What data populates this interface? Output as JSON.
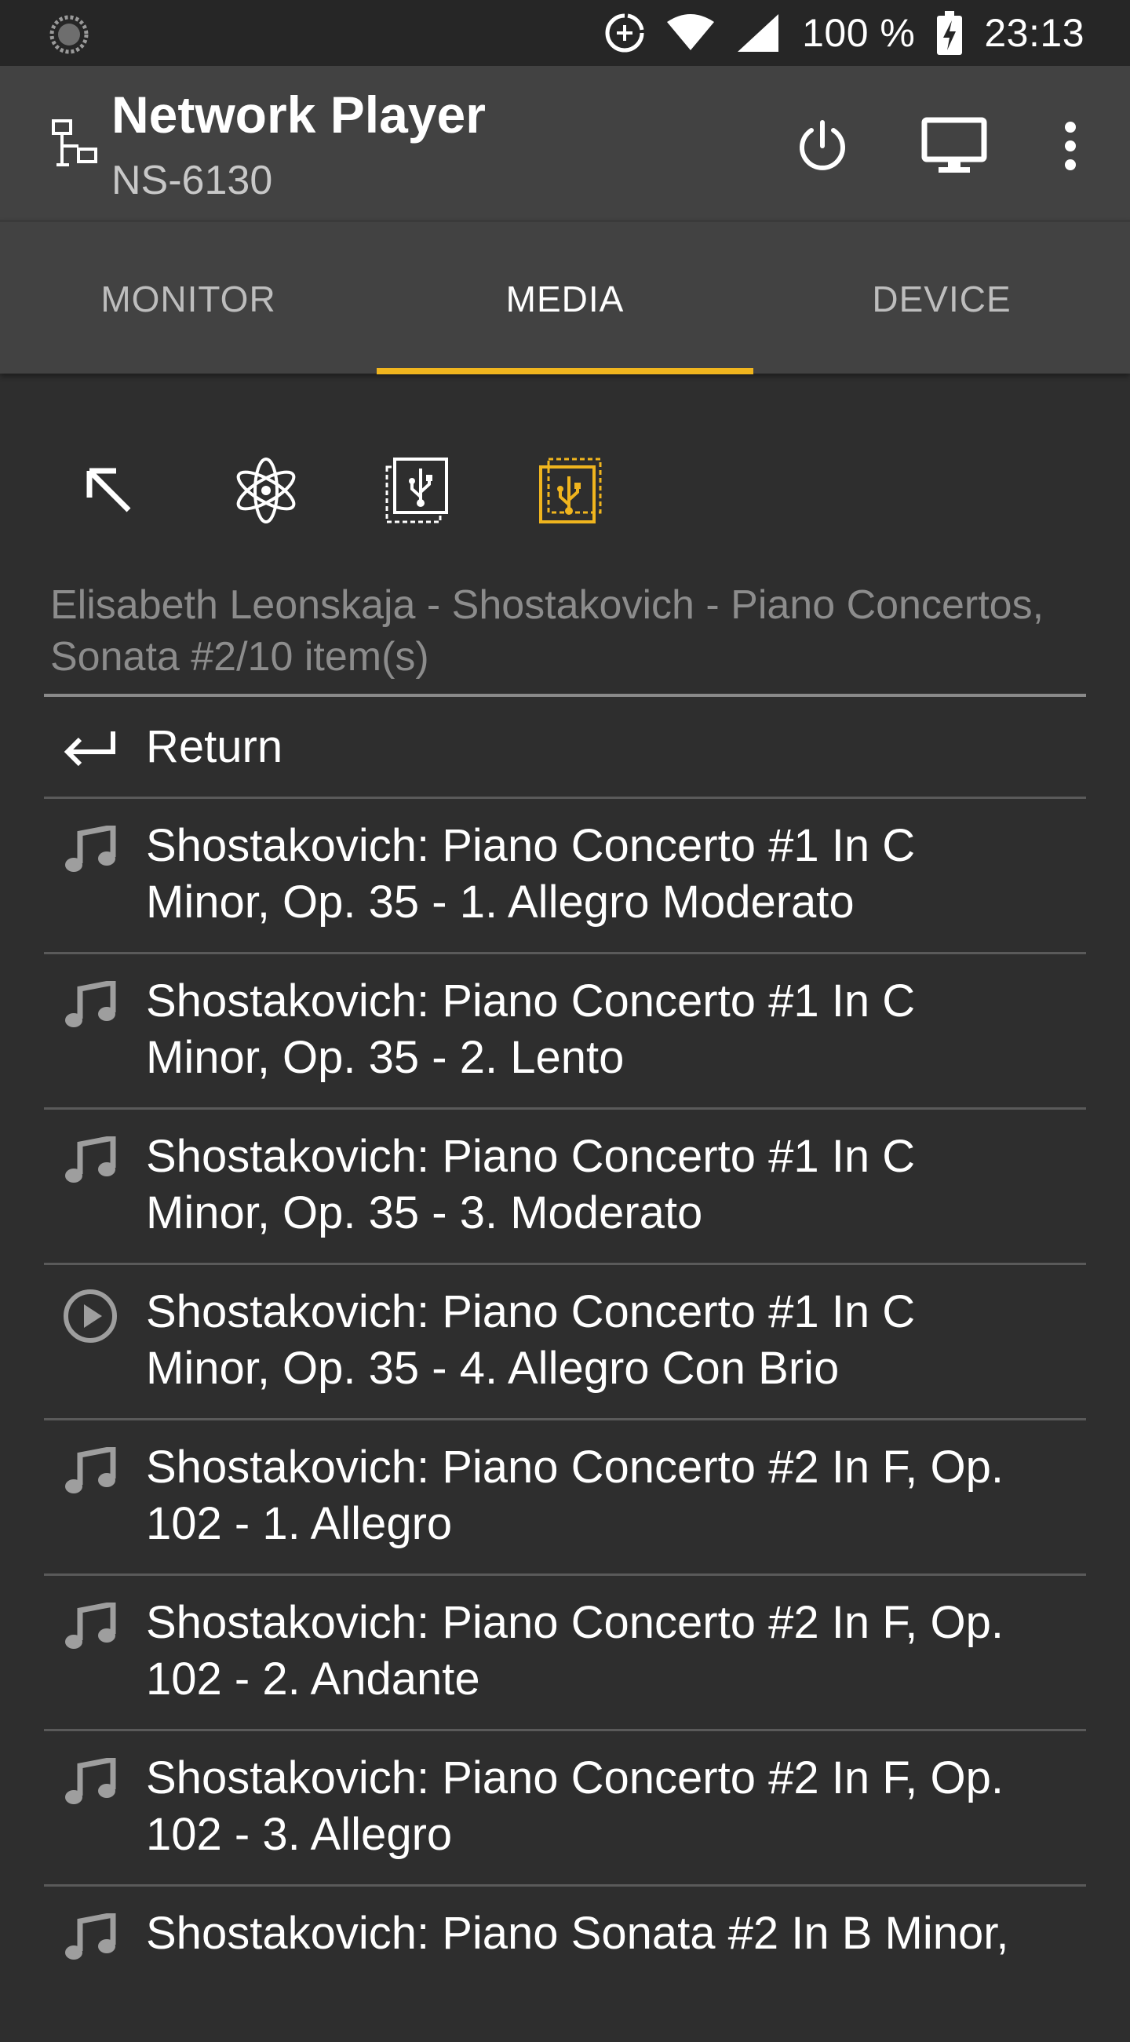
{
  "status_bar": {
    "battery": "100 %",
    "time": "23:13",
    "icons": [
      "loading-icon",
      "data-saver-icon",
      "wifi-icon",
      "signal-icon",
      "battery-charging-icon"
    ]
  },
  "app_bar": {
    "title": "Network Player",
    "subtitle": "NS-6130",
    "icons": [
      "network-icon",
      "power-icon",
      "monitor-icon",
      "more-vert-icon"
    ]
  },
  "tabs": [
    {
      "label": "MONITOR",
      "active": false
    },
    {
      "label": "MEDIA",
      "active": true
    },
    {
      "label": "DEVICE",
      "active": false
    }
  ],
  "accent_color": "#f0b51e",
  "toolbar": {
    "icons": [
      "home-arrow-icon",
      "internet-radio-icon",
      "usb-rear-icon",
      "usb-front-icon"
    ],
    "selected": "usb-front-icon"
  },
  "browser": {
    "path": "Elisabeth Leonskaja - Shostakovich - Piano Concertos, Sonata #2/10 item(s)",
    "return_label": "Return",
    "items": [
      {
        "icon": "music-note-icon",
        "line1": "Shostakovich: Piano Concerto #1 In C",
        "line2": "Minor, Op. 35 - 1. Allegro Moderato"
      },
      {
        "icon": "music-note-icon",
        "line1": "Shostakovich: Piano Concerto #1 In C",
        "line2": "Minor, Op. 35 - 2. Lento"
      },
      {
        "icon": "music-note-icon",
        "line1": "Shostakovich: Piano Concerto #1 In C",
        "line2": "Minor, Op. 35 - 3. Moderato"
      },
      {
        "icon": "play-circle-icon",
        "line1": "Shostakovich: Piano Concerto #1 In C",
        "line2": "Minor, Op. 35 - 4. Allegro Con Brio"
      },
      {
        "icon": "music-note-icon",
        "line1": "Shostakovich: Piano Concerto #2 In F, Op.",
        "line2": "102 - 1. Allegro"
      },
      {
        "icon": "music-note-icon",
        "line1": "Shostakovich: Piano Concerto #2 In F, Op.",
        "line2": "102 - 2. Andante"
      },
      {
        "icon": "music-note-icon",
        "line1": "Shostakovich: Piano Concerto #2 In F, Op.",
        "line2": "102 - 3. Allegro"
      },
      {
        "icon": "music-note-icon",
        "line1": "Shostakovich: Piano Sonata #2 In B Minor,",
        "line2": ""
      }
    ]
  }
}
